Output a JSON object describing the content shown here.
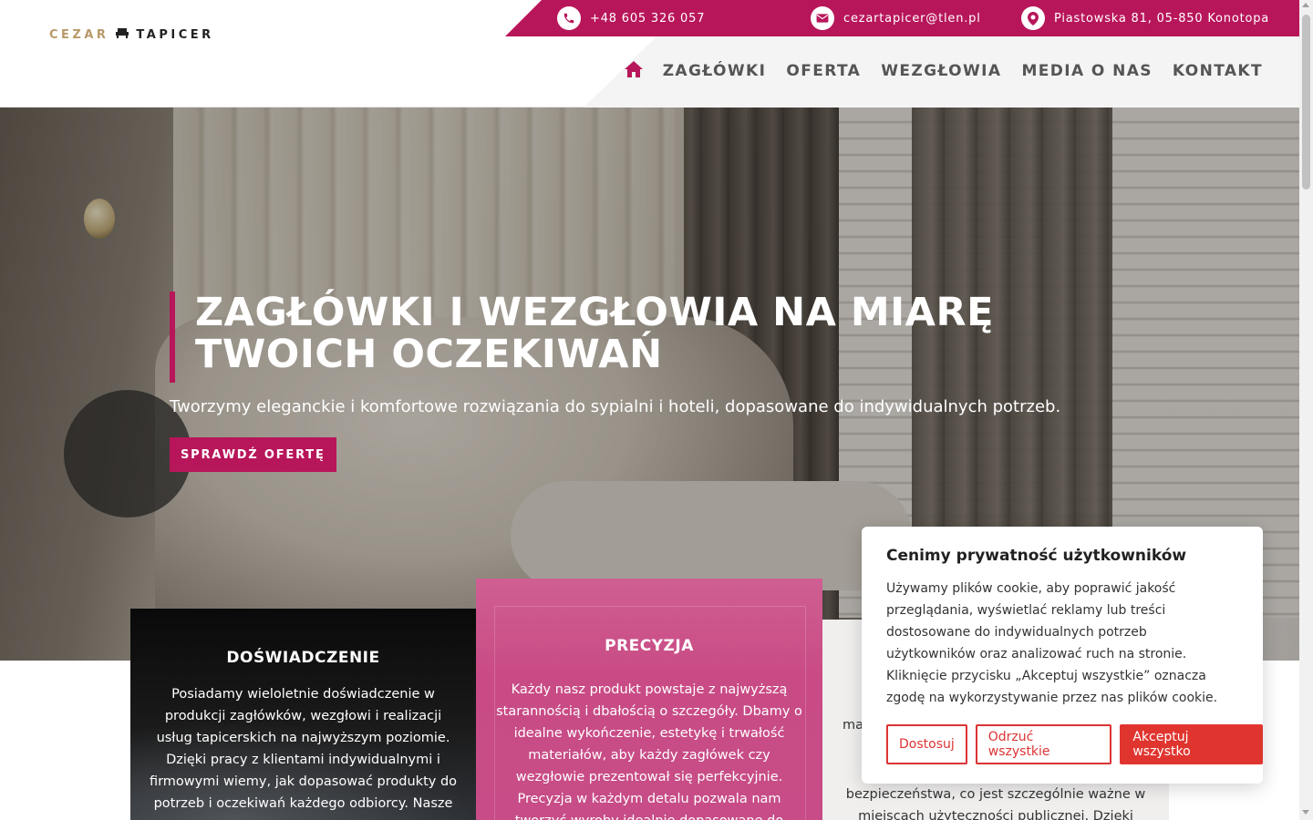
{
  "logo": {
    "part_a": "CEZAR",
    "part_b": "TAPICER",
    "icon": "sofa-icon"
  },
  "topbar": {
    "phone": "+48 605 326 057",
    "email": "cezartapicer@tlen.pl",
    "address": "Piastowska 81, 05-850 Konotopa",
    "icons": [
      "phone-icon",
      "mail-icon",
      "location-pin-icon"
    ]
  },
  "nav": {
    "home_icon": "home-icon",
    "items": [
      "ZAGŁÓWKI",
      "OFERTA",
      "WEZGŁOWIA",
      "MEDIA O NAS",
      "KONTAKT"
    ]
  },
  "hero": {
    "title": "ZAGŁÓWKI I WEZGŁOWIA NA MIARĘ TWOICH OCZEKIWAŃ",
    "subtitle": "Tworzymy eleganckie i komfortowe rozwiązania do sypialni i hoteli, dopasowane do indywidualnych potrzeb.",
    "button": "SPRAWDŹ OFERTĘ"
  },
  "features": [
    {
      "title": "DOŚWIADCZENIE",
      "text": "Posiadamy wieloletnie doświadczenie w produkcji zagłówków, wezgłowi i realizacji usług tapicerskich na najwyższym poziomie. Dzięki pracy z klientami indywidualnymi i firmowymi wiemy, jak dopasować produkty do potrzeb i oczekiwań każdego odbiorcy. Nasze"
    },
    {
      "title": "PRECYZJA",
      "text": "Każdy nasz produkt powstaje z najwyższą starannością i dbałością o szczegóły. Dbamy o idealne wykończenie, estetykę i trwałość materiałów, aby każdy zagłówek czy wezgłowie prezentował się perfekcyjnie. Precyzja w każdym detalu pozwala nam tworzyć wyroby idealnie dopasowane do indywidualnych"
    },
    {
      "fragment": "ma",
      "text": "bezpieczeństwa, co jest szczególnie ważne w miejscach użyteczności publicznej. Dzięki temu"
    }
  ],
  "cookie": {
    "title": "Cenimy prywatność użytkowników",
    "text": "Używamy plików cookie, aby poprawić jakość przeglądania, wyświetlać reklamy lub treści dostosowane do indywidualnych potrzeb użytkowników oraz analizować ruch na stronie. Kliknięcie przycisku „Akceptuj wszystkie” oznacza zgodę na wykorzystywanie przez nas plików cookie.",
    "btn_customize": "Dostosuj",
    "btn_reject": "Odrzuć wszystkie",
    "btn_accept": "Akceptuj wszystko"
  },
  "colors": {
    "accent": "#b8165a",
    "cookie_red": "#e0352f",
    "logo_gold": "#b89968"
  }
}
